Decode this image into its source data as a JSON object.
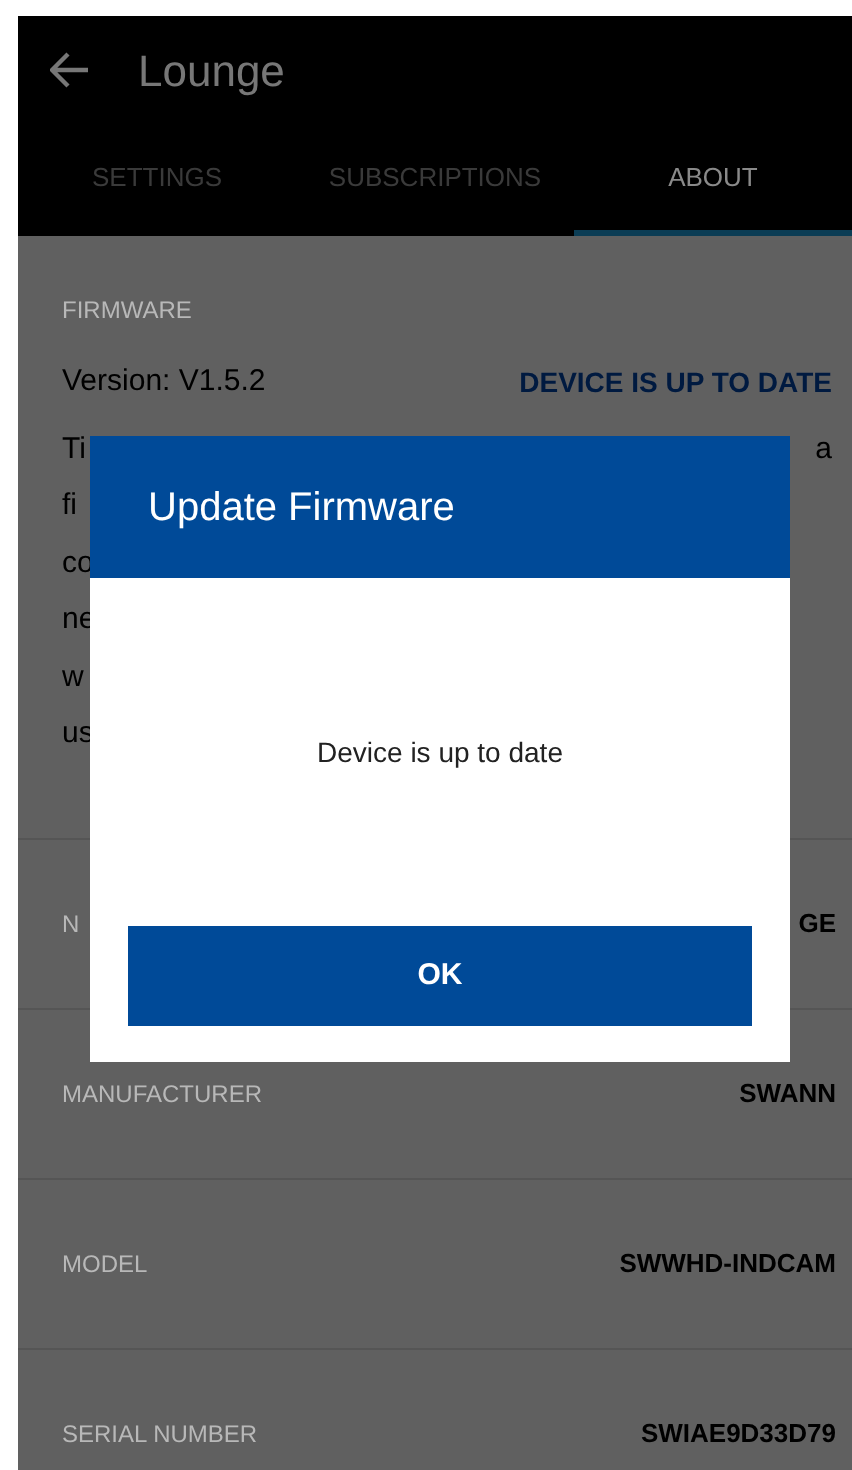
{
  "app_bar": {
    "title": "Lounge"
  },
  "tabs": [
    {
      "label": "SETTINGS",
      "selected": false
    },
    {
      "label": "SUBSCRIPTIONS",
      "selected": false
    },
    {
      "label": "ABOUT",
      "selected": true
    }
  ],
  "firmware": {
    "label": "FIRMWARE",
    "version": "Version: V1.5.2",
    "status": "DEVICE IS UP TO DATE",
    "description_fragments": [
      {
        "left": "Ti",
        "right": "a"
      },
      {
        "left": "fi"
      },
      {
        "left": "co"
      },
      {
        "left": "ne"
      },
      {
        "left": "w"
      },
      {
        "left": "us"
      }
    ]
  },
  "info_rows": [
    {
      "label": "N",
      "value": "GE"
    },
    {
      "label": "MANUFACTURER",
      "value": "SWANN"
    },
    {
      "label": "MODEL",
      "value": "SWWHD-INDCAM"
    },
    {
      "label": "SERIAL NUMBER",
      "value": "SWIAE9D33D79"
    }
  ],
  "dialog": {
    "title": "Update Firmware",
    "message": "Device is up to date",
    "button": "OK"
  }
}
